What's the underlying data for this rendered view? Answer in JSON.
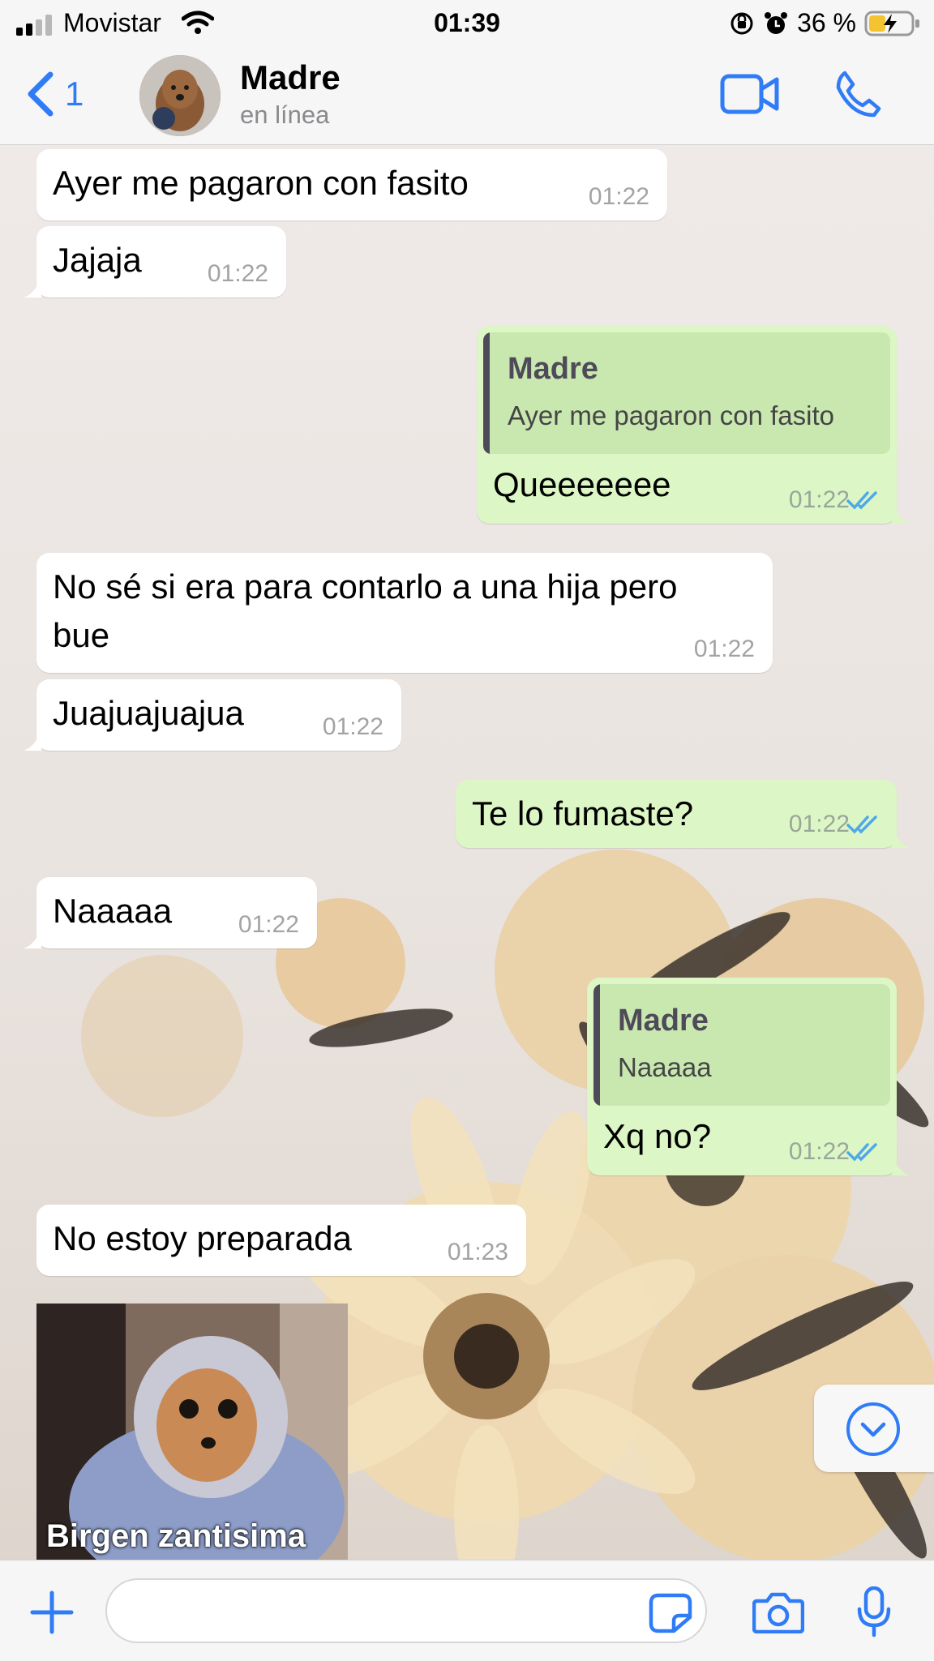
{
  "status_bar": {
    "carrier": "Movistar",
    "time": "01:39",
    "battery": "36 %"
  },
  "header": {
    "back_count": "1",
    "contact_name": "Madre",
    "contact_status": "en línea"
  },
  "messages": [
    {
      "dir": "in",
      "text": "Ayer me pagaron con fasito",
      "time": "01:22"
    },
    {
      "dir": "in",
      "text": "Jajaja",
      "time": "01:22"
    },
    {
      "dir": "out",
      "reply_to": {
        "name": "Madre",
        "text": "Ayer me pagaron con fasito"
      },
      "text": "Queeeeeee",
      "time": "01:22"
    },
    {
      "dir": "in",
      "text_line1": "No sé si era para contarlo a una hija pero",
      "text_line2": "bue",
      "time": "01:22"
    },
    {
      "dir": "in",
      "text": "Juajuajuajua",
      "time": "01:22"
    },
    {
      "dir": "out",
      "text": "Te lo fumaste?",
      "time": "01:22"
    },
    {
      "dir": "in",
      "text": "Naaaaa",
      "time": "01:22"
    },
    {
      "dir": "out",
      "reply_to": {
        "name": "Madre",
        "text": "Naaaaa"
      },
      "text": "Xq no?",
      "time": "01:22"
    },
    {
      "dir": "in",
      "text": "No estoy preparada",
      "time": "01:23"
    }
  ],
  "sticker": {
    "caption": "Birgen zantisima"
  },
  "colors": {
    "accent": "#2f7cf6",
    "outgoing_bubble": "#dcf7c5",
    "incoming_bubble": "#ffffff",
    "read_ticks": "#4fa8e8"
  },
  "icons": {
    "back": "chevron-left-icon",
    "video": "video-camera-icon",
    "call": "phone-icon",
    "plus": "plus-icon",
    "sticker": "sticker-icon",
    "camera": "camera-icon",
    "mic": "microphone-icon",
    "scroll": "chevron-down-circle-icon"
  }
}
